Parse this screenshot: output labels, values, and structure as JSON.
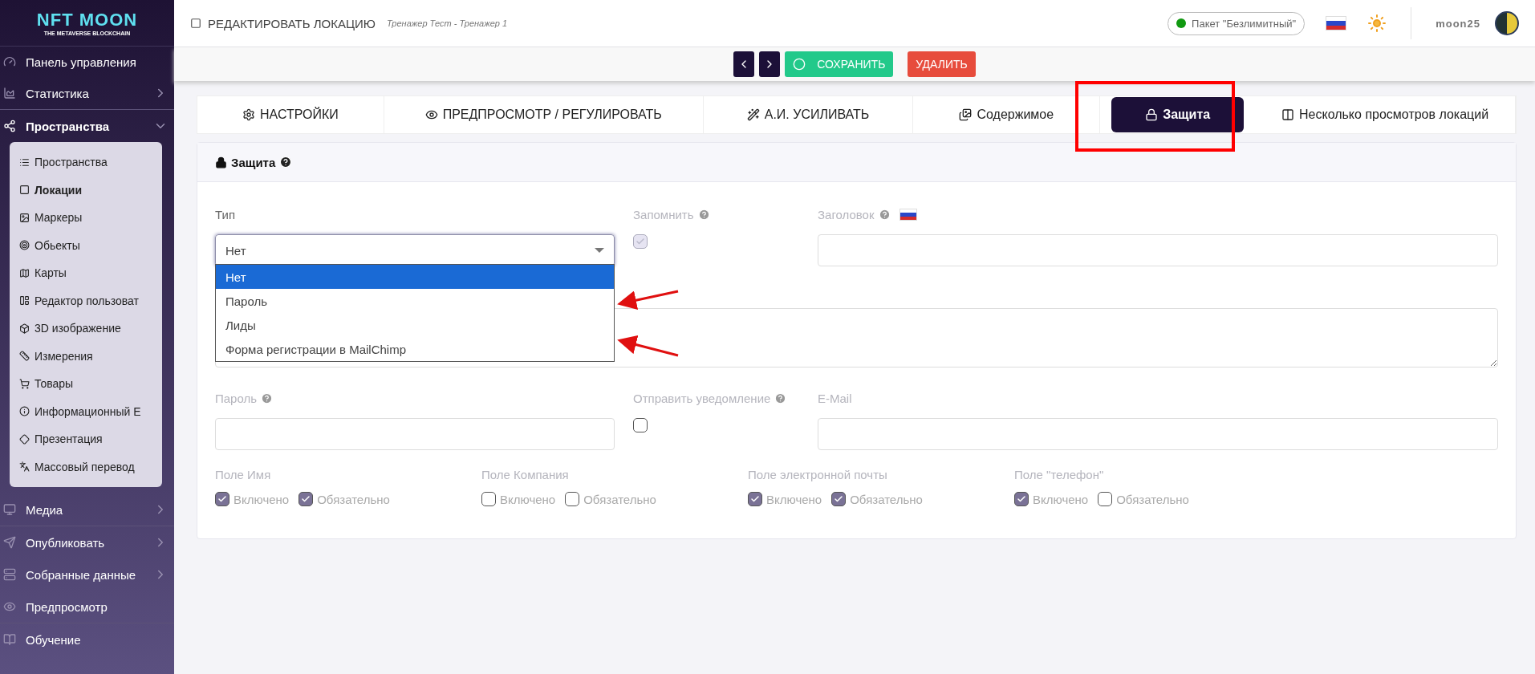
{
  "sidebar": {
    "logo": {
      "title": "NFT MOON",
      "subtitle": "THE METAVERSE BLOCKCHAIN"
    },
    "items": [
      {
        "label": "Панель управления",
        "kind": "link"
      },
      {
        "label": "Статистика",
        "kind": "group",
        "expanded": false
      },
      {
        "label": "Пространства",
        "kind": "group",
        "expanded": true,
        "children": [
          {
            "label": "Пространства",
            "selected": false
          },
          {
            "label": "Локации",
            "selected": true
          },
          {
            "label": "Маркеры",
            "selected": false
          },
          {
            "label": "Обьекты",
            "selected": false
          },
          {
            "label": "Карты",
            "selected": false
          },
          {
            "label": "Редактор пользоват",
            "selected": false
          },
          {
            "label": "3D изображение",
            "selected": false
          },
          {
            "label": "Измерения",
            "selected": false
          },
          {
            "label": "Товары",
            "selected": false
          },
          {
            "label": "Информационный Е",
            "selected": false
          },
          {
            "label": "Презентация",
            "selected": false
          },
          {
            "label": "Массовый перевод",
            "selected": false
          }
        ]
      },
      {
        "label": "Медиа",
        "kind": "group",
        "expanded": false
      },
      {
        "label": "Опубликовать",
        "kind": "group",
        "expanded": false
      },
      {
        "label": "Собранные данные",
        "kind": "group",
        "expanded": false
      },
      {
        "label": "Предпросмотр",
        "kind": "link"
      },
      {
        "label": "Обучение",
        "kind": "link"
      }
    ]
  },
  "header": {
    "title": "РЕДАКТИРОВАТЬ ЛОКАЦИЮ",
    "subtitle": "Тренажер Тест - Тренажер 1",
    "plan": "Пакет \"Безлимитный\"",
    "username": "moon25"
  },
  "toolbar": {
    "save": "СОХРАНИТЬ",
    "delete": "УДАЛИТЬ"
  },
  "tabs": [
    {
      "label": "НАСТРОЙКИ",
      "selected": false
    },
    {
      "label": "ПРЕДПРОСМОТР / РЕГУЛИРОВАТЬ",
      "selected": false
    },
    {
      "label": "А.И. УСИЛИВАТЬ",
      "selected": false
    },
    {
      "label": "Содержимое",
      "selected": false
    },
    {
      "label": "Защита",
      "selected": true
    },
    {
      "label": "Несколько просмотров локаций",
      "selected": false
    }
  ],
  "card": {
    "title": "Защита",
    "type": {
      "label": "Тип",
      "value": "Нет",
      "options": [
        {
          "label": "Нет",
          "selected": true
        },
        {
          "label": "Пароль",
          "selected": false
        },
        {
          "label": "Лиды",
          "selected": false
        },
        {
          "label": "Форма регистрации в MailChimp",
          "selected": false
        }
      ]
    },
    "remember": {
      "label": "Запомнить",
      "checked": true,
      "disabled": true
    },
    "heading": {
      "label": "Заголовок"
    },
    "password": {
      "label": "Пароль"
    },
    "notify": {
      "label": "Отправить уведомление",
      "checked": false,
      "disabled": false
    },
    "email": {
      "label": "E-Mail"
    },
    "field_groups": [
      {
        "label": "Поле Имя",
        "enabled": {
          "label": "Включено",
          "checked": true
        },
        "required": {
          "label": "Обязательно",
          "checked": true
        }
      },
      {
        "label": "Поле Компания",
        "enabled": {
          "label": "Включено",
          "checked": false
        },
        "required": {
          "label": "Обязательно",
          "checked": false
        }
      },
      {
        "label": "Поле электронной почты",
        "enabled": {
          "label": "Включено",
          "checked": true
        },
        "required": {
          "label": "Обязательно",
          "checked": true
        }
      },
      {
        "label": "Поле \"телефон\"",
        "enabled": {
          "label": "Включено",
          "checked": true
        },
        "required": {
          "label": "Обязательно",
          "checked": false
        }
      }
    ]
  }
}
